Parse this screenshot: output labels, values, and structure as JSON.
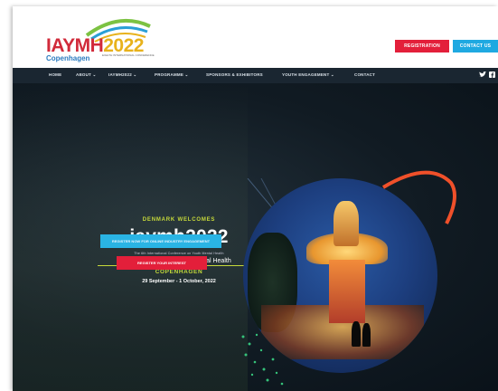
{
  "header": {
    "logo_text": "IAYMH",
    "logo_year": "2022",
    "logo_city": "Copenhagen",
    "logo_subtext": "EIGHTH INTERNATIONAL CONFERENCE",
    "registration_label": "REGISTRATION",
    "contact_label": "CONTACT US"
  },
  "nav": {
    "items": [
      {
        "label": "HOME"
      },
      {
        "label": "ABOUT ⌄"
      },
      {
        "label": "IAYMH2022 ⌄"
      },
      {
        "label": "PROGRAMME ⌄"
      },
      {
        "label": "SPONSORS & EXHIBITORS"
      },
      {
        "label": "YOUTH ENGAGEMENT ⌄"
      },
      {
        "label": "CONTACT"
      }
    ],
    "social": [
      "twitter-icon",
      "facebook-icon"
    ]
  },
  "hero": {
    "welcomes": "DENMARK WELCOMES",
    "title": "iaymh2022",
    "subtitle": "The 6th International Conference on Youth Mental Health",
    "tagline": "REIMAGINING | Youth Mental Health",
    "city": "COPENHAGEN",
    "dates": "29 September - 1 October, 2022",
    "btn_primary": "REGISTER NOW FOR ONLINE INDUSTRY ENGAGEMENT",
    "btn_secondary": "REGISTER YOUR INTEREST"
  },
  "colors": {
    "brand_red": "#e31f3a",
    "brand_blue": "#1fa9e1",
    "accent_lime": "#c6d93a",
    "nav_bg": "#1a2631",
    "hero_bg": "#111b23"
  }
}
